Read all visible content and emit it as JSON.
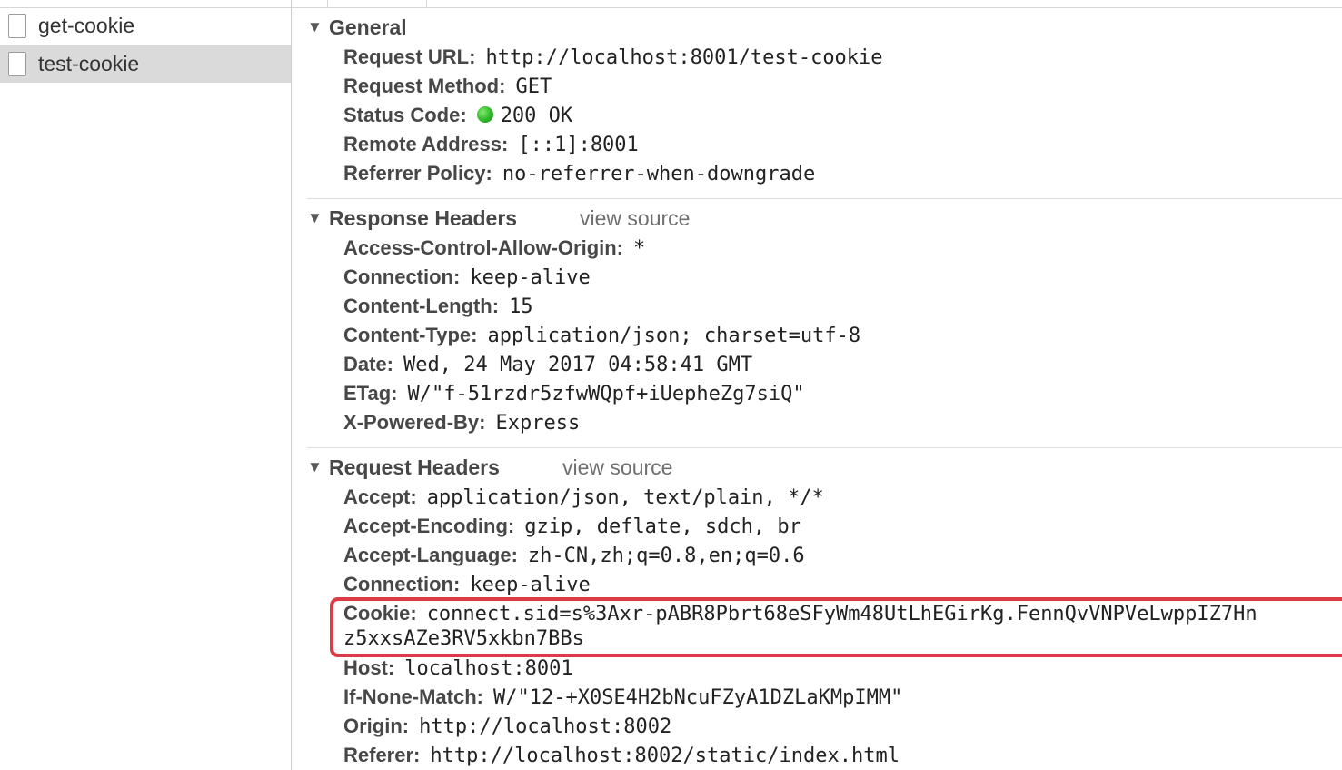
{
  "requests": [
    {
      "name": "get-cookie",
      "selected": false
    },
    {
      "name": "test-cookie",
      "selected": true
    }
  ],
  "general": {
    "title": "General",
    "rows": [
      {
        "key": "Request URL:",
        "value": "http://localhost:8001/test-cookie"
      },
      {
        "key": "Request Method:",
        "value": "GET"
      },
      {
        "key": "Status Code:",
        "value": "200 OK",
        "status_color": "#2fb62a"
      },
      {
        "key": "Remote Address:",
        "value": "[::1]:8001"
      },
      {
        "key": "Referrer Policy:",
        "value": "no-referrer-when-downgrade"
      }
    ]
  },
  "response_headers": {
    "title": "Response Headers",
    "view_source": "view source",
    "rows": [
      {
        "key": "Access-Control-Allow-Origin:",
        "value": "*"
      },
      {
        "key": "Connection:",
        "value": "keep-alive"
      },
      {
        "key": "Content-Length:",
        "value": "15"
      },
      {
        "key": "Content-Type:",
        "value": "application/json; charset=utf-8"
      },
      {
        "key": "Date:",
        "value": "Wed, 24 May 2017 04:58:41 GMT"
      },
      {
        "key": "ETag:",
        "value": "W/\"f-51rzdr5zfwWQpf+iUepheZg7siQ\""
      },
      {
        "key": "X-Powered-By:",
        "value": "Express"
      }
    ]
  },
  "request_headers": {
    "title": "Request Headers",
    "view_source": "view source",
    "rows": [
      {
        "key": "Accept:",
        "value": "application/json, text/plain, */*"
      },
      {
        "key": "Accept-Encoding:",
        "value": "gzip, deflate, sdch, br"
      },
      {
        "key": "Accept-Language:",
        "value": "zh-CN,zh;q=0.8,en;q=0.6"
      },
      {
        "key": "Connection:",
        "value": "keep-alive"
      },
      {
        "key": "Cookie:",
        "value": "connect.sid=s%3Axr-pABR8Pbrt68eSFyWm48UtLhEGirKg.FennQvVNPVeLwppIZ7Hn",
        "continuation": "z5xxsAZe3RV5xkbn7BBs"
      },
      {
        "key": "Host:",
        "value": "localhost:8001"
      },
      {
        "key": "If-None-Match:",
        "value": "W/\"12-+X0SE4H2bNcuFZyA1DZLaKMpIMM\""
      },
      {
        "key": "Origin:",
        "value": "http://localhost:8002"
      },
      {
        "key": "Referer:",
        "value": "http://localhost:8002/static/index.html"
      }
    ]
  },
  "colors": {
    "highlight_box": "#dd3b46",
    "selected_row": "#dadada"
  },
  "icons": {
    "expand": "triangle-down-icon",
    "request": "document-icon",
    "status": "status-dot-icon"
  }
}
